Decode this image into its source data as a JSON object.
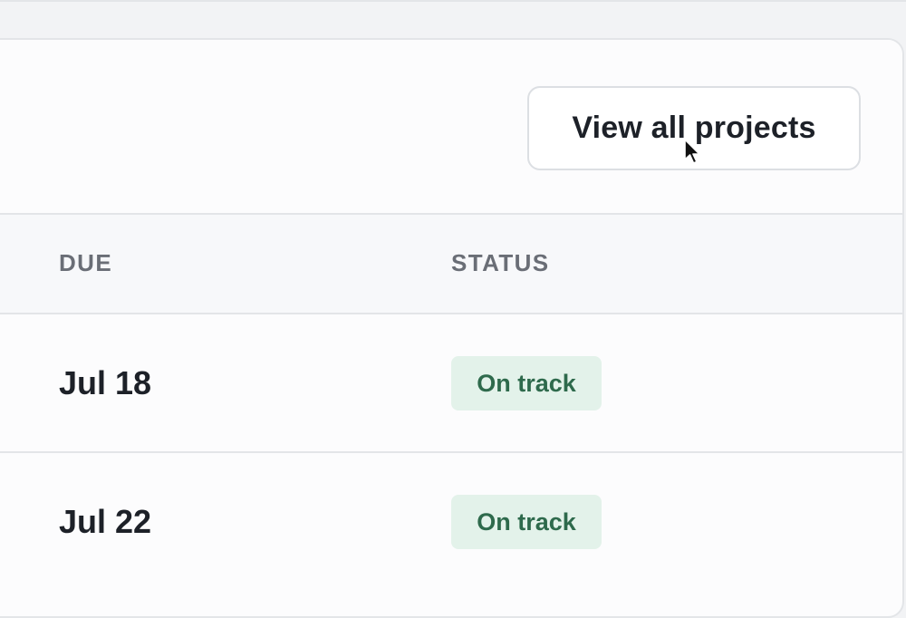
{
  "header": {
    "view_all_label": "View all projects"
  },
  "table": {
    "columns": [
      "DUE",
      "STATUS"
    ],
    "rows": [
      {
        "due": "Jul 18",
        "status": "On track"
      },
      {
        "due": "Jul 22",
        "status": "On track"
      }
    ]
  },
  "colors": {
    "status_on_track_bg": "#e3f2ea",
    "status_on_track_text": "#2e6a4c"
  },
  "icons": {
    "cursor": "mouse-pointer-icon"
  }
}
